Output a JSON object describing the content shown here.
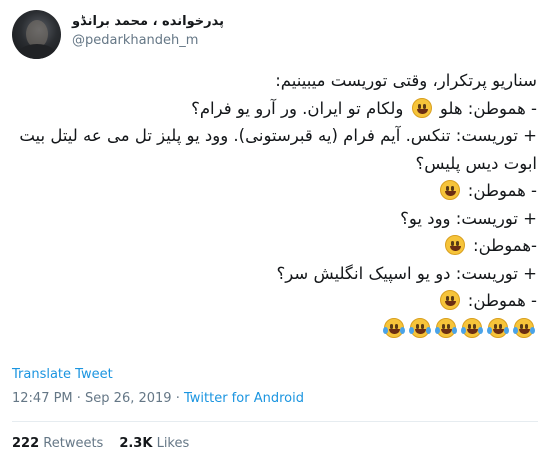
{
  "author": {
    "display_name": "پدرخوانده ، محمد برانڈو",
    "handle": "@pedarkhandeh_m"
  },
  "tweet": {
    "lines": [
      "سناریو پرتکرار، وقتی توریست میبینیم:",
      "- هموطن: هلو [smile] ولکام تو ایران. ور آرو یو فرام؟",
      "+ توریست: تنکس. آیم فرام (یه قبرستونی). وود یو پلیز تل می عه لیتل بیت",
      "ابوت دیس پلیس؟",
      "- هموطن: [smile]",
      "+ توریست: وود یو؟",
      "-هموطن: [smile]",
      "+ توریست: دو یو اسپیک انگلیش سر؟",
      "- هموطن: [smile]",
      "[joy][joy][joy][joy][joy][joy]"
    ],
    "emoji_names": {
      "smile": "grinning-face-icon",
      "joy": "tears-of-joy-icon"
    },
    "translate_label": "Translate Tweet",
    "timestamp": "12:47 PM · Sep 26, 2019",
    "separator": " · ",
    "source": "Twitter for Android"
  },
  "stats": {
    "retweets_count": "222",
    "retweets_label": "Retweets",
    "likes_count": "2.3K",
    "likes_label": "Likes"
  },
  "colors": {
    "link": "#1b95e0",
    "muted": "#657786",
    "text": "#14171a",
    "emoji": "#f6c43a"
  }
}
